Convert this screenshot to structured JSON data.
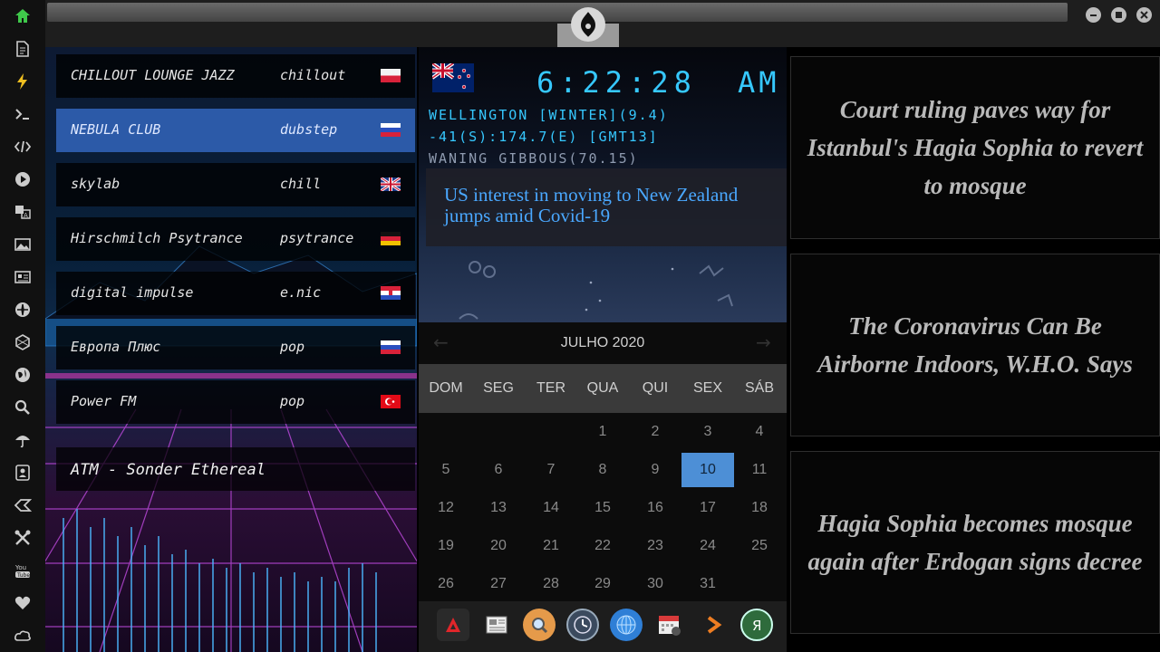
{
  "radio": {
    "stations": [
      {
        "name": "CHILLOUT LOUNGE JAZZ",
        "genre": "chillout",
        "flag": "poland-flag"
      },
      {
        "name": "NEBULA CLUB",
        "genre": "dubstep",
        "flag": "russia-flag",
        "active": true
      },
      {
        "name": "skylab",
        "genre": "chill",
        "flag": "uk-flag"
      },
      {
        "name": "Hirschmilch Psytrance",
        "genre": "psytrance",
        "flag": "germany-flag"
      },
      {
        "name": "digital impulse",
        "genre": "e.nic",
        "flag": "croatia-flag"
      },
      {
        "name": "Европа Плюс",
        "genre": "pop",
        "flag": "russia-flag"
      },
      {
        "name": "Power FM",
        "genre": "pop",
        "flag": "turkey-flag"
      }
    ],
    "now_playing": "ATM - Sonder Ethereal"
  },
  "clock": {
    "time": "6:22:28",
    "ampm": "AM",
    "location_line1": "WELLINGTON [WINTER](9.4)",
    "location_line2": "-41(S):174.7(E) [GMT13]",
    "moon_phase": "WANING GIBBOUS(70.15)",
    "news": "US interest in moving to New Zealand jumps amid Covid-19"
  },
  "calendar": {
    "month": "JULHO 2020",
    "prev": "←",
    "next": "→",
    "weekdays": [
      "DOM",
      "SEG",
      "TER",
      "QUA",
      "QUI",
      "SEX",
      "SÁB"
    ],
    "weeks": [
      [
        "",
        "",
        "",
        "1",
        "2",
        "3",
        "4"
      ],
      [
        "5",
        "6",
        "7",
        "8",
        "9",
        "10",
        "11"
      ],
      [
        "12",
        "13",
        "14",
        "15",
        "16",
        "17",
        "18"
      ],
      [
        "19",
        "20",
        "21",
        "22",
        "23",
        "24",
        "25"
      ],
      [
        "26",
        "27",
        "28",
        "29",
        "30",
        "31",
        ""
      ]
    ],
    "selected": "10"
  },
  "headlines": [
    "Court ruling paves way for Istanbul's Hagia Sophia to revert to mosque",
    "The Coronavirus Can Be Airborne Indoors, W.H.O. Says",
    "Hagia Sophia becomes mosque again after Erdogan signs decree"
  ],
  "sidebar_icons": [
    "home-icon",
    "document-icon",
    "lightning-icon",
    "terminal-icon",
    "code-icon",
    "play-icon",
    "translate-icon",
    "image-icon",
    "news-icon",
    "jedi-icon",
    "hexagon-icon",
    "globe-icon",
    "search-icon",
    "umbrella-icon",
    "contact-icon",
    "tag-icon",
    "tools-icon",
    "youtube-icon",
    "heart-icon",
    "cloud-icon"
  ],
  "dock_icons": [
    "app-a-icon",
    "newspaper-icon",
    "search-icon",
    "clock-icon",
    "globe-icon",
    "calendar-icon",
    "arrow-icon",
    "yandex-icon"
  ],
  "colors": {
    "accent": "#36c8ff",
    "selected": "#4d8fd6",
    "link": "#4aa8ff",
    "active_station": "#2c5aa8"
  }
}
